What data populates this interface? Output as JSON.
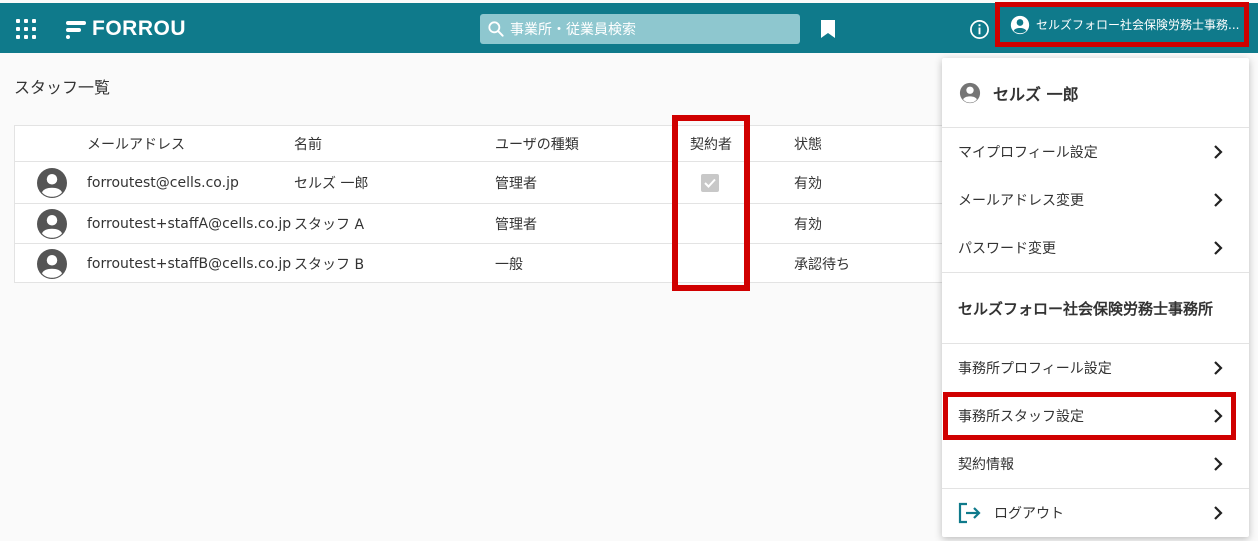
{
  "header": {
    "brand": "FORROU",
    "search_placeholder": "事業所・従業員検索",
    "account_label": "セルズフォロー社会保険労務士事務..."
  },
  "page": {
    "title": "スタッフ一覧"
  },
  "table": {
    "columns": [
      "メールアドレス",
      "名前",
      "ユーザの種類",
      "契約者",
      "状態"
    ],
    "rows": [
      {
        "email": "forroutest@cells.co.jp",
        "name": "セルズ 一郎",
        "type": "管理者",
        "contract": true,
        "status": "有効"
      },
      {
        "email": "forroutest+staffA@cells.co.jp",
        "name": "スタッフ A",
        "type": "管理者",
        "contract": false,
        "status": "有効"
      },
      {
        "email": "forroutest+staffB@cells.co.jp",
        "name": "スタッフ B",
        "type": "一般",
        "contract": false,
        "status": "承認待ち"
      }
    ]
  },
  "menu": {
    "user_name": "セルズ 一郎",
    "user_items": [
      "マイプロフィール設定",
      "メールアドレス変更",
      "パスワード変更"
    ],
    "office_name": "セルズフォロー社会保険労務士事務所",
    "office_items": [
      "事務所プロフィール設定",
      "事務所スタッフ設定",
      "契約情報"
    ],
    "logout": "ログアウト"
  },
  "colors": {
    "topbar": "#0f7a8b",
    "highlight": "#d00000",
    "search_bg": "#8ec7cf"
  }
}
